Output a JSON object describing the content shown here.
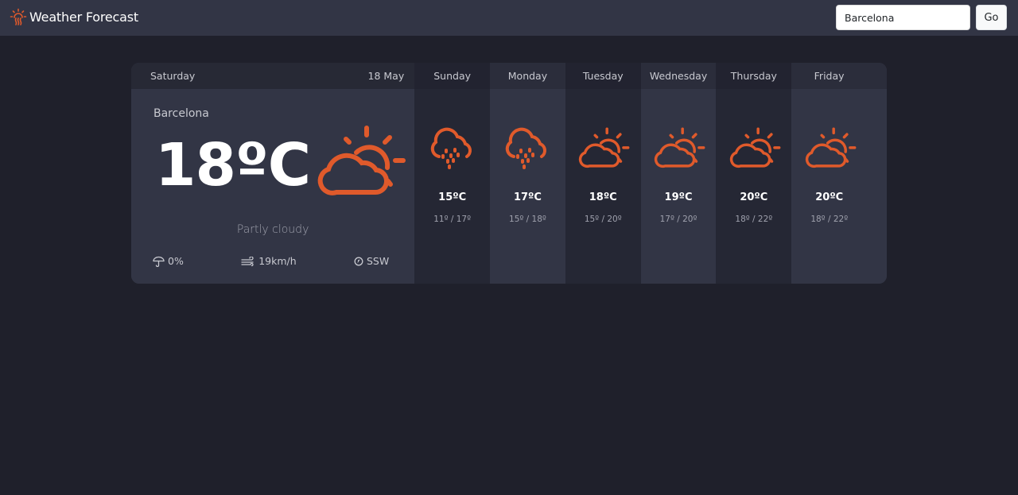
{
  "app": {
    "title": "Weather Forecast",
    "icon": "sun-heat-icon"
  },
  "search": {
    "value": "Barcelona",
    "placeholder": "",
    "button_label": "Go"
  },
  "colors": {
    "accent": "#e05a2b",
    "background": "#1f202b",
    "navbar": "#323545",
    "card": "#323545"
  },
  "today": {
    "day": "Saturday",
    "date": "18 May",
    "location": "Barcelona",
    "temperature": "18ºC",
    "condition": "Partly cloudy",
    "icon": "partly-cloudy-icon",
    "precipitation": "0%",
    "wind_speed": "19km/h",
    "wind_direction": "SSW"
  },
  "forecast": [
    {
      "day": "Sunday",
      "icon": "rain-icon",
      "temp": "15ºC",
      "range": "11º / 17º"
    },
    {
      "day": "Monday",
      "icon": "rain-icon",
      "temp": "17ºC",
      "range": "15º / 18º"
    },
    {
      "day": "Tuesday",
      "icon": "partly-cloudy-icon",
      "temp": "18ºC",
      "range": "15º / 20º"
    },
    {
      "day": "Wednesday",
      "icon": "partly-cloudy-icon",
      "temp": "19ºC",
      "range": "17º / 20º"
    },
    {
      "day": "Thursday",
      "icon": "partly-cloudy-icon",
      "temp": "20ºC",
      "range": "18º / 22º"
    },
    {
      "day": "Friday",
      "icon": "partly-cloudy-icon",
      "temp": "20ºC",
      "range": "18º / 22º"
    }
  ]
}
